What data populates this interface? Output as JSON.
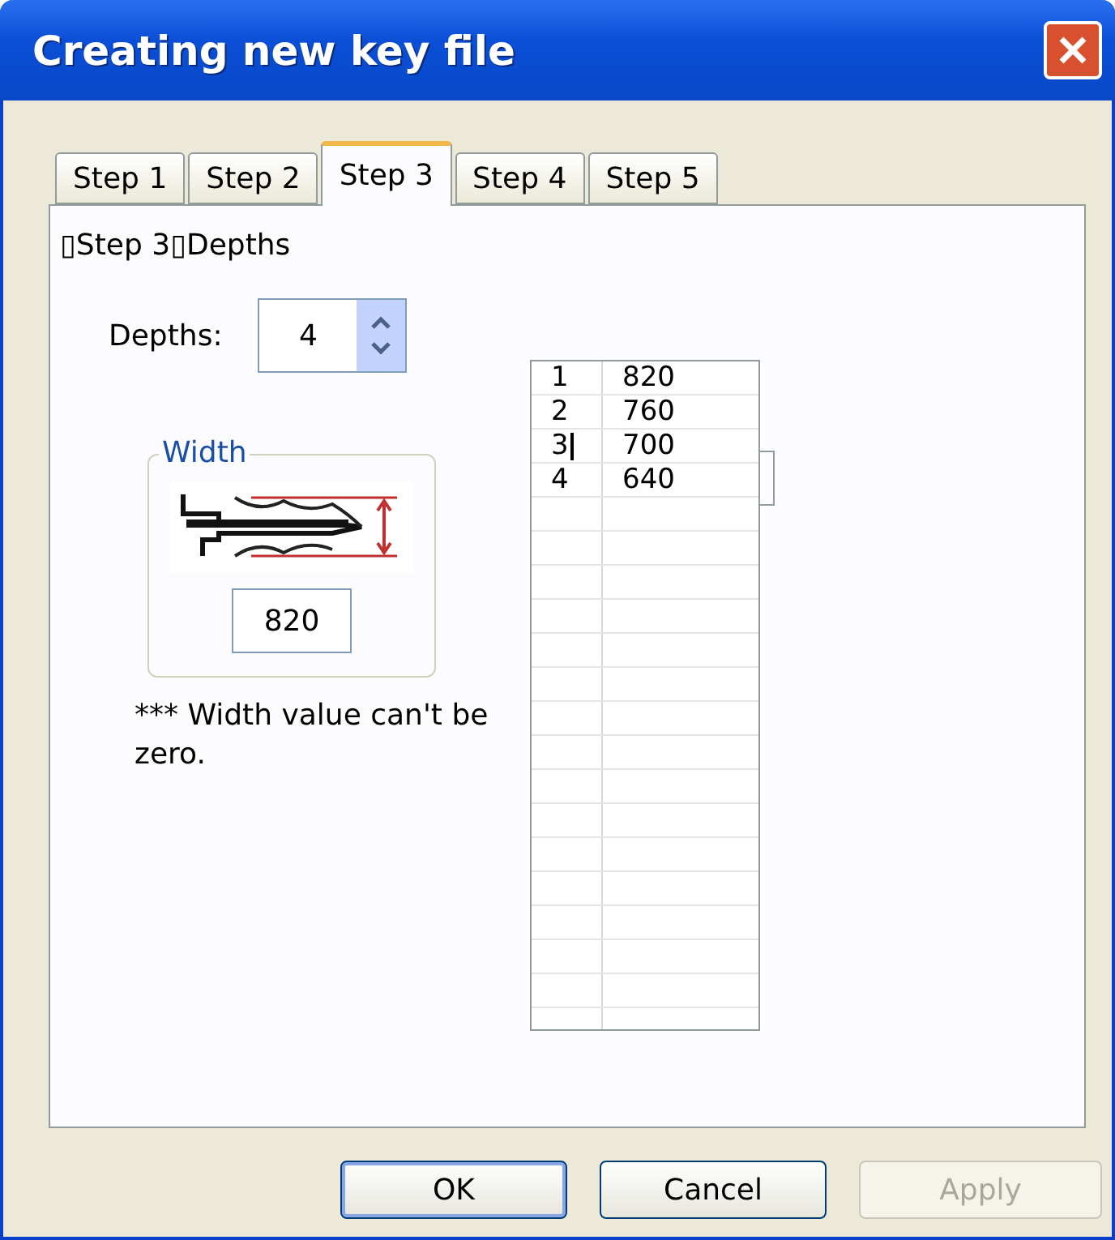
{
  "window": {
    "title": "Creating new key file"
  },
  "tabs": [
    {
      "label": "Step 1",
      "selected": false
    },
    {
      "label": "Step 2",
      "selected": false
    },
    {
      "label": "Step 3",
      "selected": true
    },
    {
      "label": "Step 4",
      "selected": false
    },
    {
      "label": "Step 5",
      "selected": false
    }
  ],
  "heading": "▯Step 3▯Depths",
  "depths": {
    "label": "Depths:",
    "value": "4"
  },
  "width_group": {
    "title": "Width",
    "value": "820"
  },
  "note": "*** Width value can't be zero.",
  "table": {
    "rows": [
      {
        "index": "1",
        "value": "820",
        "editing": false
      },
      {
        "index": "2",
        "value": "760",
        "editing": false
      },
      {
        "index": "3",
        "value": "700",
        "editing": true
      },
      {
        "index": "4",
        "value": "640",
        "editing": false
      }
    ]
  },
  "buttons": [
    {
      "label": "OK",
      "disabled": false,
      "default": true
    },
    {
      "label": "Cancel",
      "disabled": false,
      "default": false
    },
    {
      "label": "Apply",
      "disabled": true,
      "default": false
    }
  ]
}
